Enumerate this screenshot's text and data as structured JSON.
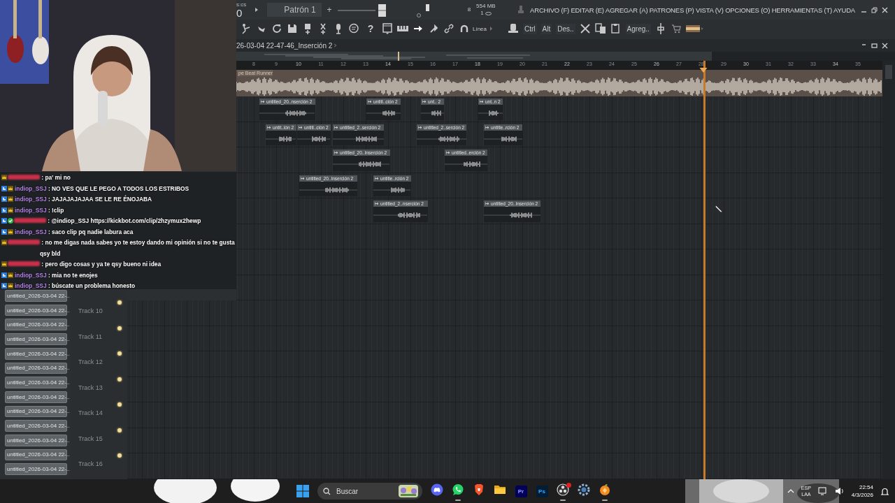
{
  "top_bar": {
    "time_unit": "s:cs",
    "counter": "0",
    "pattern": "Patrón 1",
    "add": "+",
    "cpu": "8",
    "memory": "554 MB",
    "polyphony": "1",
    "menu": "ARCHIVO (F) EDITAR (E) AGREGAR (A) PATRONES (P) VISTA (V) OPCIONES (O) HERRAMIENTAS (T) AYUDA"
  },
  "toolbar": {
    "help": "?",
    "snap": "Línea",
    "keys": [
      "Ctrl",
      "Alt",
      "Des.."
    ],
    "add": "Agreg.."
  },
  "playlist": {
    "title": "26-03-04 22-47-46_Inserción 2",
    "ruler": [
      "8",
      "9",
      "10",
      "11",
      "12",
      "13",
      "14",
      "15",
      "16",
      "17",
      "18",
      "19",
      "20",
      "21",
      "22",
      "23",
      "24",
      "25",
      "26",
      "27",
      "28",
      "29",
      "30",
      "31",
      "32",
      "33",
      "34",
      "35"
    ],
    "audio_track": {
      "label": "pe Beat Runner"
    },
    "lanes": [
      {
        "clips": [
          "untitled_20..nserción 2",
          "untitl..ción 2",
          "unt.. 2",
          "unt..n 2"
        ]
      },
      {
        "clips": [
          "untit..ión 2",
          "untitl..ción 2",
          "untitled_2..serción 2",
          "untitled_2..serción 2",
          "untitle..rción 2"
        ]
      },
      {
        "clips": [
          "untitled_20..Inserción 2",
          "untitled..erción 2"
        ]
      },
      {
        "clips": [
          "untitled_20..Inserción 2",
          "untitle..rción 2"
        ]
      },
      {
        "clips": [
          "untitled_2..nserción 2",
          "untitled_20..Inserción 2"
        ]
      }
    ],
    "tracks": [
      {
        "name": "Track 10",
        "enabled": true
      },
      {
        "name": "Track 11",
        "enabled": true
      },
      {
        "name": "Track 12",
        "enabled": true
      },
      {
        "name": "Track 13",
        "enabled": true
      },
      {
        "name": "Track 14",
        "enabled": true
      },
      {
        "name": "Track 15",
        "enabled": true
      },
      {
        "name": "Track 16",
        "enabled": true
      }
    ],
    "clip_list": [
      "untitled_2026-03-04 22-..",
      "untitled_2026-03-04 22-..",
      "untitled_2026-03-04 22-..",
      "untitled_2026-03-04 22-..",
      "untitled_2026-03-04 22-..",
      "untitled_2026-03-04 22-..",
      "untitled_2026-03-04 22-..",
      "untitled_2026-03-04 22-..",
      "untitled_2026-03-04 22-..",
      "untitled_2026-03-04 22-..",
      "untitled_2026-03-04 22-..",
      "untitled_2026-03-04 22-..",
      "untitled_2026-03-04 22-.."
    ]
  },
  "chat": [
    {
      "hidden": true,
      "color": "#c8304a",
      "badges": [
        {
          "kind": "crown"
        }
      ],
      "text": ": pa' mi no"
    },
    {
      "hidden": false,
      "user": "indiop_SSJ",
      "color": "#b482e8",
      "badges": [
        {
          "kind": "kick"
        },
        {
          "kind": "crown"
        }
      ],
      "text": ": NO VES QUE LE PEGO A TODOS LOS ESTRIBOS"
    },
    {
      "hidden": false,
      "user": "indiop_SSJ",
      "color": "#b482e8",
      "badges": [
        {
          "kind": "kick"
        },
        {
          "kind": "crown"
        }
      ],
      "text": ": JAJAJAJAJAA SE LE RE ÉNOJABA"
    },
    {
      "hidden": false,
      "user": "indiop_SSJ",
      "color": "#b482e8",
      "badges": [
        {
          "kind": "kick"
        },
        {
          "kind": "crown"
        }
      ],
      "text": ": !clip"
    },
    {
      "hidden": true,
      "color": "#c8304a",
      "badges": [
        {
          "kind": "kick"
        },
        {
          "kind": "verified"
        }
      ],
      "text": ": @indiop_SSJ https://kickbot.com/clip/2hzymux2hewp"
    },
    {
      "hidden": false,
      "user": "indiop_SSJ",
      "color": "#b482e8",
      "badges": [
        {
          "kind": "kick"
        },
        {
          "kind": "crown"
        }
      ],
      "text": ": saco clip pq nadie labura aca"
    },
    {
      "hidden": true,
      "color": "#c8304a",
      "badges": [
        {
          "kind": "crown"
        }
      ],
      "text": ": no me digas nada sabes yo te estoy dando mi opinión si no te gusta qsy bld"
    },
    {
      "hidden": true,
      "color": "#c8304a",
      "badges": [
        {
          "kind": "crown"
        }
      ],
      "text": ": pero digo cosas y ya te qsy bueno ni idea"
    },
    {
      "hidden": false,
      "user": "indiop_SSJ",
      "color": "#b482e8",
      "badges": [
        {
          "kind": "kick"
        },
        {
          "kind": "crown"
        }
      ],
      "text": ": mia no te enojes"
    },
    {
      "hidden": false,
      "user": "indiop_SSJ",
      "color": "#b482e8",
      "badges": [
        {
          "kind": "kick"
        },
        {
          "kind": "crown"
        }
      ],
      "text": ": búscate un problema honesto"
    }
  ],
  "taskbar": {
    "search": "Buscar",
    "apps": [
      {
        "kind": "discord",
        "running": false,
        "notification": false
      },
      {
        "kind": "whatsapp",
        "running": true,
        "notification": false
      },
      {
        "kind": "brave",
        "running": false,
        "notification": false
      },
      {
        "kind": "folder",
        "running": false,
        "notification": false
      },
      {
        "kind": "premiere",
        "label": "Pr",
        "running": false,
        "notification": false
      },
      {
        "kind": "photoshop",
        "label": "Ps",
        "running": false,
        "notification": false
      },
      {
        "kind": "obs",
        "running": true,
        "notification": true
      },
      {
        "kind": "settings",
        "running": false,
        "notification": false
      },
      {
        "kind": "fl",
        "running": true,
        "notification": false
      }
    ],
    "language": "ESP",
    "layout": "LAA",
    "time": "22:54",
    "date": "4/3/2026"
  }
}
